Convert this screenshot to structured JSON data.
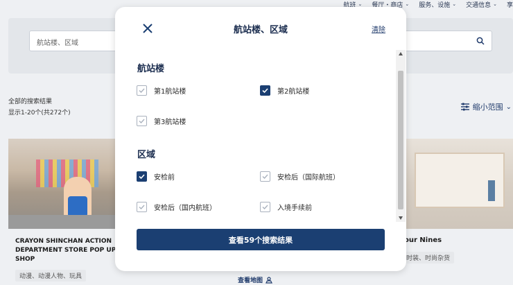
{
  "topnav": {
    "items": [
      "航班",
      "餐厅・商店",
      "服务、设施",
      "交通信息",
      "享"
    ]
  },
  "search": {
    "placeholder": "航站楼、区域"
  },
  "results": {
    "title": "全部的搜索结果",
    "count": "显示1-20个(共272个)",
    "narrow_label": "缩小范围"
  },
  "cards": {
    "left_title": "CRAYON SHINCHAN ACTION DEPARTMENT STORE POP UP SHOP",
    "left_tag": "动漫、动漫人物、玩具",
    "right_title": "our Nines",
    "right_tag": "时装、时尚杂货",
    "map_link": "查看地图"
  },
  "modal": {
    "title": "航站楼、区域",
    "clear_label": "清除",
    "terminal_heading": "航站楼",
    "terminal_options": [
      {
        "label": "第1航站楼",
        "checked": false
      },
      {
        "label": "第2航站楼",
        "checked": true
      },
      {
        "label": "第3航站楼",
        "checked": false
      }
    ],
    "area_heading": "区域",
    "area_options": [
      {
        "label": "安检前",
        "checked": true
      },
      {
        "label": "安检后（国际航班）",
        "checked": false
      },
      {
        "label": "安检后（国内航班）",
        "checked": false
      },
      {
        "label": "入境手续前",
        "checked": false
      }
    ],
    "cta_label": "查看59个搜索结果"
  },
  "colors": {
    "primary": "#1b3f72",
    "page_bg": "#eef0f3"
  }
}
